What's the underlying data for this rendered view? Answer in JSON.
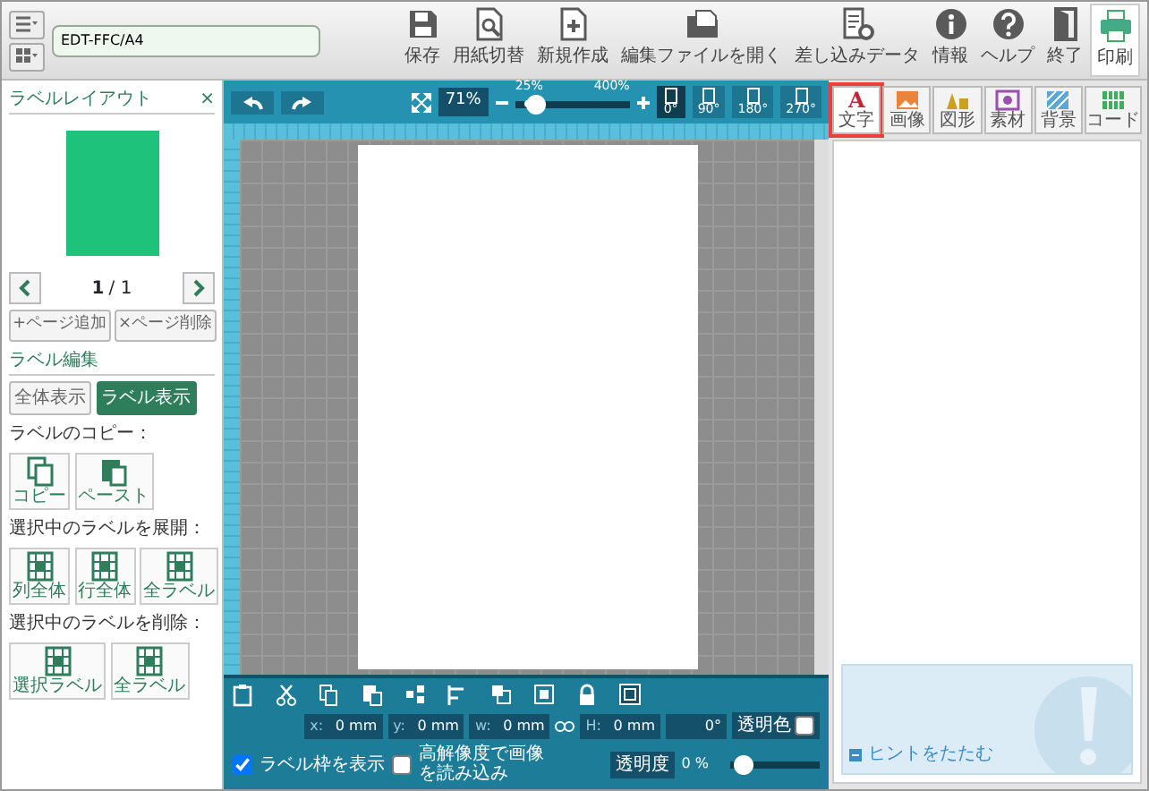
{
  "file_name": "EDT-FFC/A4",
  "toolbar": [
    {
      "label": "保存",
      "kind": "save"
    },
    {
      "label": "用紙切替",
      "kind": "paper"
    },
    {
      "label": "新規作成",
      "kind": "new"
    },
    {
      "label": "編集ファイルを開く",
      "kind": "open"
    },
    {
      "label": "差し込みデータ",
      "kind": "merge"
    },
    {
      "label": "情報",
      "kind": "info"
    },
    {
      "label": "ヘルプ",
      "kind": "help"
    },
    {
      "label": "終了",
      "kind": "exit"
    },
    {
      "label": "印刷",
      "kind": "print"
    }
  ],
  "left_panel": {
    "title": "ラベルレイアウト",
    "close": "×",
    "page": {
      "current": "1",
      "total": "/ 1"
    },
    "page_buttons": [
      {
        "icon": "+",
        "label": "ページ追加"
      },
      {
        "icon": "×",
        "label": "ページ削除"
      }
    ],
    "edit_title": "ラベル編集",
    "view_buttons": [
      {
        "label": "全体表示",
        "selected": false
      },
      {
        "label": "ラベル表示",
        "selected": true
      }
    ],
    "groups": [
      {
        "heading": "ラベルのコピー：",
        "buttons": [
          {
            "label": "コピー",
            "kind": "copy"
          },
          {
            "label": "ペースト",
            "kind": "paste"
          }
        ]
      },
      {
        "heading": "選択中のラベルを展開：",
        "buttons": [
          {
            "label": "列全体",
            "kind": "grid"
          },
          {
            "label": "行全体",
            "kind": "grid"
          },
          {
            "label": "全ラベル",
            "kind": "grid"
          }
        ]
      },
      {
        "heading": "選択中のラベルを削除：",
        "buttons": [
          {
            "label": "選択ラベル",
            "kind": "grid"
          },
          {
            "label": "全ラベル",
            "kind": "grid"
          }
        ]
      }
    ]
  },
  "canvas_toolbar": {
    "zoom": {
      "value": "71%",
      "min_label": "25%",
      "max_label": "400%",
      "level": 0.12
    },
    "rotations": [
      {
        "label": "0°",
        "selected": true
      },
      {
        "label": "90°",
        "selected": false
      },
      {
        "label": "180°",
        "selected": false
      },
      {
        "label": "270°",
        "selected": false
      }
    ]
  },
  "properties": {
    "fields": [
      {
        "label": "x:",
        "value": "0 mm"
      },
      {
        "label": "y:",
        "value": "0 mm"
      },
      {
        "label": "w:",
        "value": "0 mm"
      },
      {
        "label": "H:",
        "value": "0 mm"
      }
    ],
    "rotation": "0°",
    "transparent_color": {
      "label": "透明色",
      "checked": false
    },
    "options": [
      {
        "label": "ラベル枠を表示",
        "checked": true
      },
      {
        "label": "高解像度で画像を読み込み",
        "checked": false
      }
    ],
    "opacity": {
      "label": "透明度",
      "value": "0 %",
      "level": 0.05
    }
  },
  "tabs": [
    {
      "label": "文字",
      "kind": "text",
      "glyph": "A",
      "selected": true
    },
    {
      "label": "画像",
      "kind": "image",
      "selected": false
    },
    {
      "label": "図形",
      "kind": "shape",
      "selected": false
    },
    {
      "label": "素材",
      "kind": "material",
      "selected": false
    },
    {
      "label": "背景",
      "kind": "background",
      "selected": false
    },
    {
      "label": "コード",
      "kind": "code",
      "selected": false
    }
  ],
  "hint": {
    "label": "ヒントをたたむ"
  }
}
